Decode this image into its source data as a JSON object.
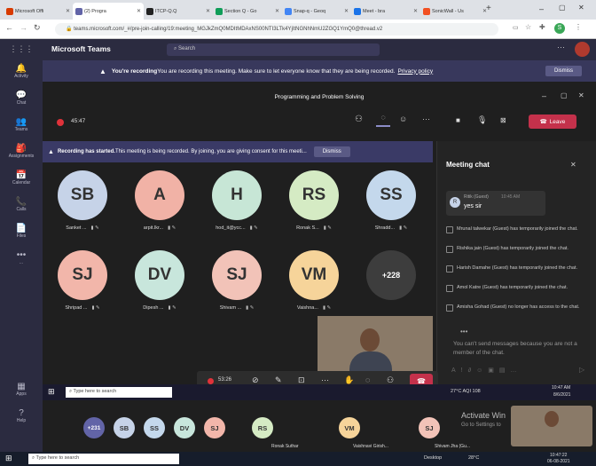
{
  "browser": {
    "tabs": [
      {
        "label": "Microsoft Offi",
        "color": "#d83b01",
        "active": false
      },
      {
        "label": "(2) Progra",
        "color": "#6264a7",
        "active": true
      },
      {
        "label": "ITCP-Q.Q",
        "color": "#222222",
        "active": false
      },
      {
        "label": "Section Q - Go",
        "color": "#0f9d58",
        "active": false
      },
      {
        "label": "Snap-q - Geoq",
        "color": "#4285f4",
        "active": false
      },
      {
        "label": "Meet - bra",
        "color": "#1a73e8",
        "active": false
      },
      {
        "label": "SonicWall - Us",
        "color": "#f25022",
        "active": false
      }
    ],
    "new_tab": "+",
    "url": "teams.microsoft.com/_#/pre-join-calling/19:meeting_MGJkZmQ0MDItMDAxNS00NTI3LTk4YjItNGNhNmU2ZGQ1YmQ0@thread.v2"
  },
  "rail": {
    "items": [
      {
        "label": "Activity",
        "glyph": "🔔"
      },
      {
        "label": "Chat",
        "glyph": "💬"
      },
      {
        "label": "Teams",
        "glyph": "👥"
      },
      {
        "label": "Assignments",
        "glyph": "🎒"
      },
      {
        "label": "Calendar",
        "glyph": "📅"
      },
      {
        "label": "Calls",
        "glyph": "📞"
      },
      {
        "label": "Files",
        "glyph": "📄"
      },
      {
        "label": "...",
        "glyph": "•••"
      }
    ],
    "bottom": [
      {
        "label": "Apps",
        "glyph": "▦"
      },
      {
        "label": "Help",
        "glyph": "?"
      }
    ]
  },
  "teams": {
    "title": "Microsoft Teams",
    "search_placeholder": "Search"
  },
  "recording_banner": {
    "bold": "You're recording",
    "text": " You are recording this meeting. Make sure to let everyone know that they are being recorded.",
    "link": "Privacy policy",
    "dismiss": "Dismiss"
  },
  "meeting": {
    "title": "Programming and Problem Solving",
    "timer": "45:47",
    "leave": "Leave"
  },
  "consent_banner": {
    "bold": "Recording has started.",
    "text": " This meeting is being recorded. By joining, you are giving consent for this meeti...",
    "dismiss": "Dismiss"
  },
  "participants": [
    {
      "initials": "SB",
      "name": "Sanket ...",
      "color": "#c6d3e8"
    },
    {
      "initials": "A",
      "name": "arpit.lkr...",
      "color": "#f1b2a6"
    },
    {
      "initials": "H",
      "name": "hod_it@ycc...",
      "color": "#c7e6d6"
    },
    {
      "initials": "RS",
      "name": "Ronak S...",
      "color": "#d5ebc4"
    },
    {
      "initials": "SS",
      "name": "Shradd...",
      "color": "#c4d8ec"
    },
    {
      "initials": "SJ",
      "name": "Shripad ...",
      "color": "#f2b6aa"
    },
    {
      "initials": "DV",
      "name": "Dipesh ...",
      "color": "#c8e6dc"
    },
    {
      "initials": "SJ",
      "name": "Shivam ...",
      "color": "#f2c3b8"
    },
    {
      "initials": "VM",
      "name": "Vaishna...",
      "color": "#f6d49a"
    },
    {
      "initials": "+228",
      "name": "",
      "color": "#3d3d3d"
    }
  ],
  "chat": {
    "title": "Meeting chat",
    "message": {
      "author": "Ritik (Guest)",
      "time": "10:45 AM",
      "text": "yes sir",
      "initials": "R"
    },
    "events": [
      "Mrunal talwekar (Guest) has temporarily joined the chat.",
      "Rishika jain (Guest) has temporarily joined the chat.",
      "Harish Damahe (Guest) has temporarily joined the chat.",
      "Amol Katre (Guest) has temporarily joined the chat.",
      "Amisha Gohad (Guest) no longer has access to the chat."
    ],
    "disabled_note": "You can't send messages because you are not a member of the chat.",
    "typing": "•••"
  },
  "call_controls": {
    "timer": "53:26"
  },
  "inner_taskbar": {
    "search": "Type here to search",
    "weather": "27°C  AQI 108",
    "time": "10:47 AM",
    "date": "8/6/2021"
  },
  "bottom_strip": {
    "overflow": "+231",
    "avatars": [
      {
        "initials": "SB",
        "color": "#c6d3e8"
      },
      {
        "initials": "SS",
        "color": "#c4d8ec"
      },
      {
        "initials": "DV",
        "color": "#c8e6dc"
      },
      {
        "initials": "SJ",
        "color": "#f2b6aa"
      },
      {
        "initials": "RS",
        "color": "#d5ebc4"
      },
      {
        "initials": "VM",
        "color": "#f6d49a"
      },
      {
        "initials": "SJ",
        "color": "#f2c3b8"
      }
    ],
    "names": [
      "Ronak Suthar",
      "Vaishnavi Girish...",
      "Shivam Jha (Gu..."
    ],
    "activate": "Activate Win",
    "activate_sub": "Go to Settings to"
  },
  "os_taskbar": {
    "search": "Type here to search",
    "desktop": "Desktop",
    "weather": "28°C",
    "time": "10:47:22",
    "date": "06-08-2021"
  },
  "colors": {
    "accent": "#6264a7",
    "leave": "#c4314b",
    "banner": "#38385c",
    "record": "#e0323a"
  }
}
